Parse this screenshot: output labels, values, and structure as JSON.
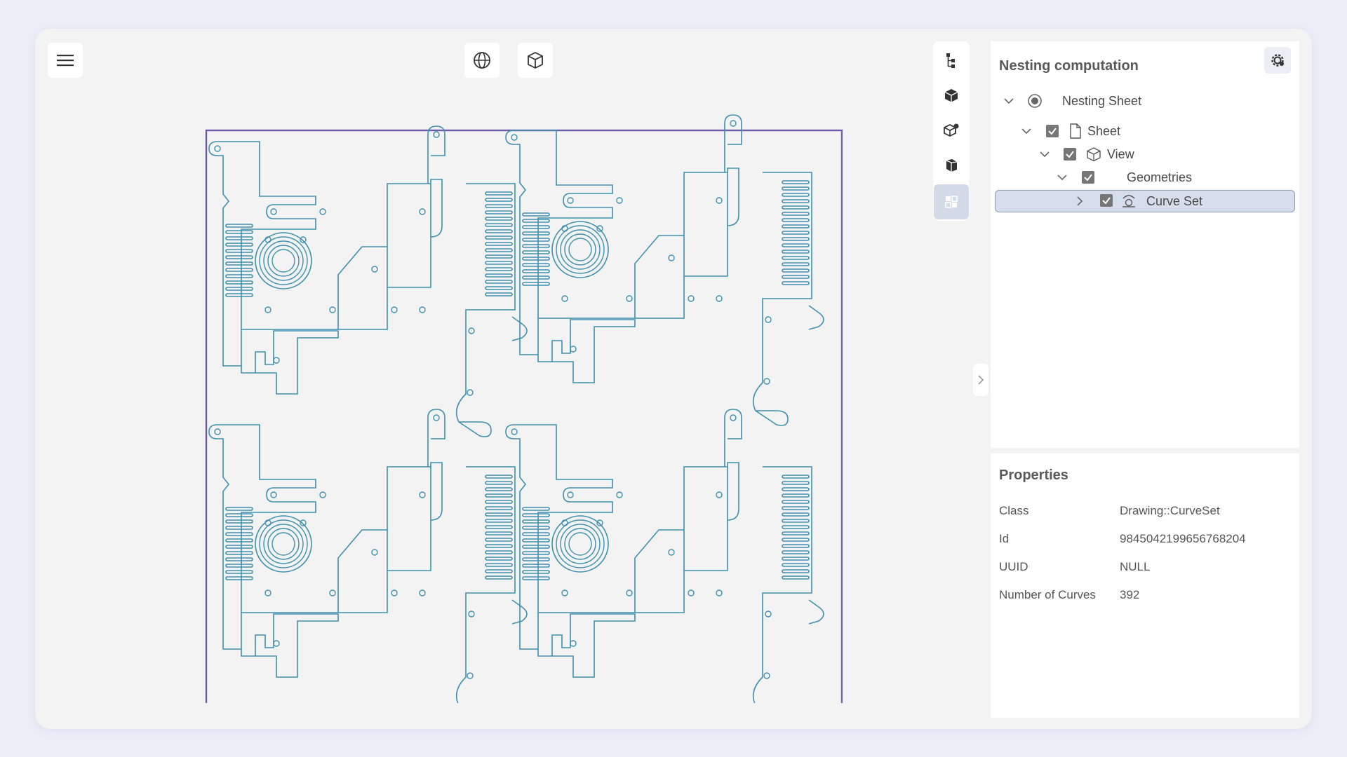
{
  "toolbar": {
    "menu_icon": "hamburger-icon",
    "top_tools": [
      "globe-icon",
      "cube-icon"
    ]
  },
  "side_toolbar": {
    "tools": [
      "tree-icon",
      "solid-cube-icon",
      "cube-connect-icon",
      "box-side-icon",
      "grid-view-icon"
    ],
    "active_index": 4
  },
  "tree": {
    "title": "Nesting computation",
    "settings_icon": "gear-icon",
    "nodes": [
      {
        "label": "Nesting Sheet",
        "icon": "radio-icon",
        "expanded": true
      },
      {
        "label": "Sheet",
        "icon": "document-icon",
        "checked": true,
        "expanded": true
      },
      {
        "label": "View",
        "icon": "cube-outline-icon",
        "checked": true,
        "expanded": true
      },
      {
        "label": "Geometries",
        "checked": true,
        "expanded": true
      },
      {
        "label": "Curve Set",
        "icon": "curve-set-icon",
        "checked": true,
        "expanded": false,
        "selected": true
      }
    ]
  },
  "properties": {
    "title": "Properties",
    "rows": [
      {
        "label": "Class",
        "value": "Drawing::CurveSet"
      },
      {
        "label": "Id",
        "value": "9845042199656768204"
      },
      {
        "label": "UUID",
        "value": "NULL"
      },
      {
        "label": "Number of Curves",
        "value": "392"
      }
    ]
  },
  "colors": {
    "sheet_border": "#6a5ca8",
    "curve": "#3f8fae",
    "selection": "#d6deec"
  }
}
